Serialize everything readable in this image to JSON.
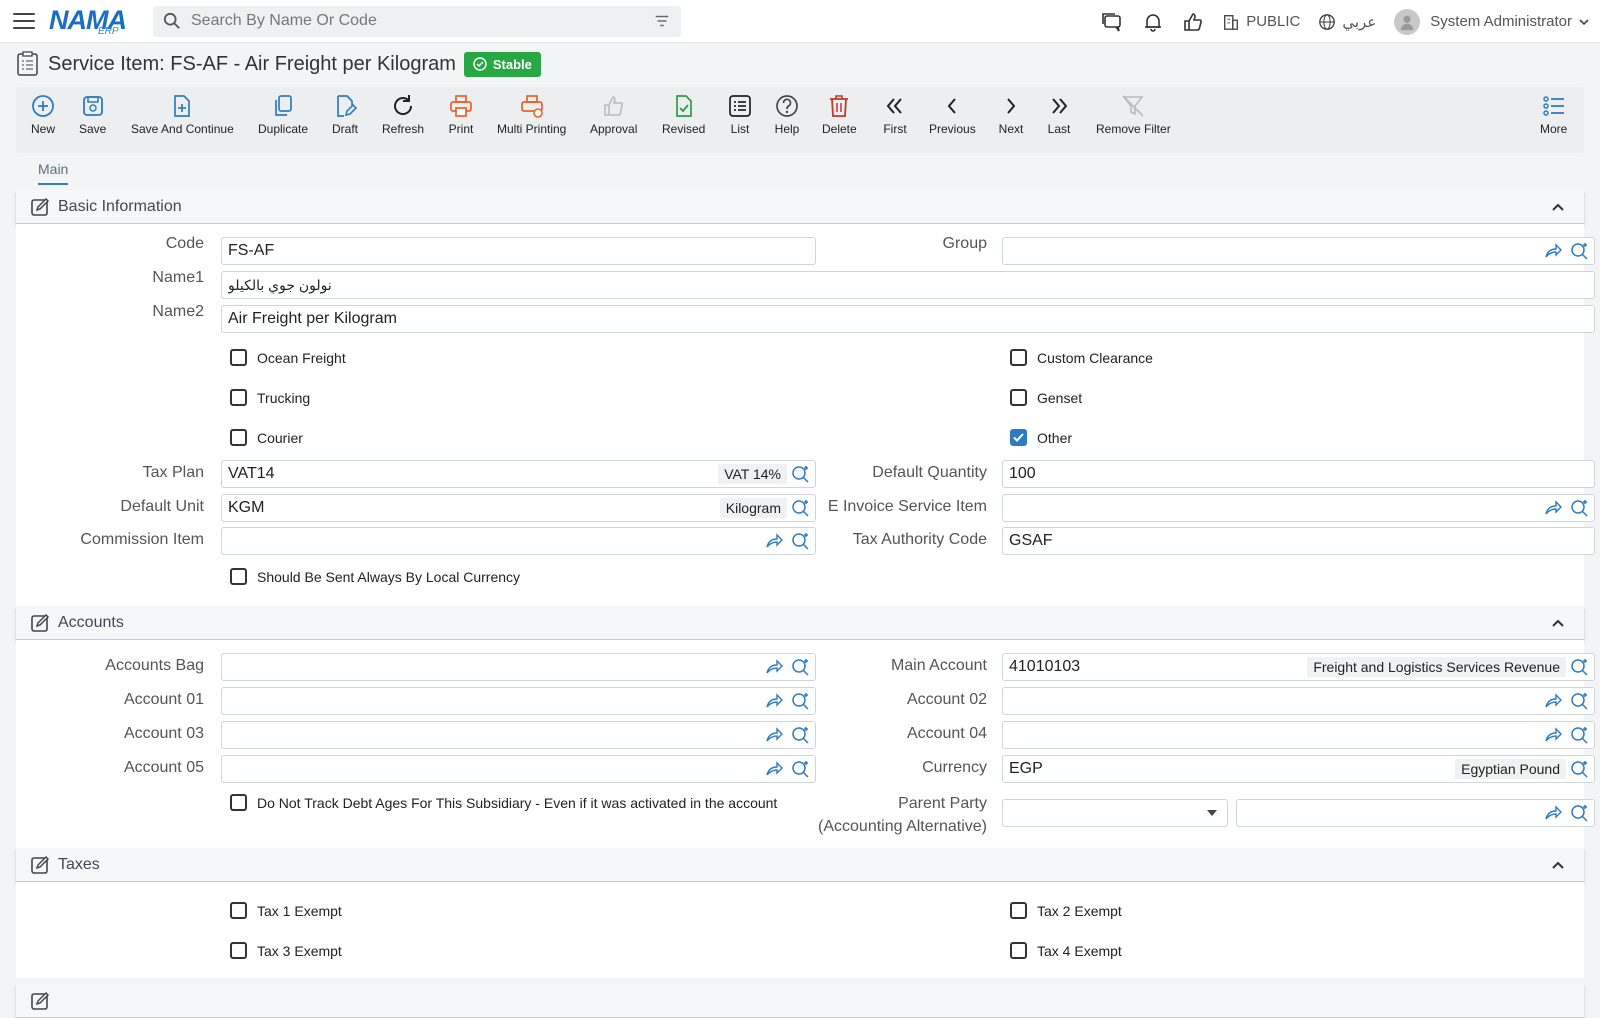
{
  "topbar": {
    "logo_main": "NAMA",
    "logo_sub": "ERP",
    "search_placeholder": "Search By Name Or Code",
    "branch": "PUBLIC",
    "language": "عربي",
    "user": "System Administrator"
  },
  "page": {
    "title": "Service Item: FS-AF - Air Freight per Kilogram",
    "status": "Stable"
  },
  "toolbar": {
    "new": "New",
    "save": "Save",
    "save_continue": "Save And Continue",
    "duplicate": "Duplicate",
    "draft": "Draft",
    "refresh": "Refresh",
    "print": "Print",
    "multi_printing": "Multi Printing",
    "approval": "Approval",
    "revised": "Revised",
    "list": "List",
    "help": "Help",
    "delete": "Delete",
    "first": "First",
    "previous": "Previous",
    "next": "Next",
    "last": "Last",
    "remove_filter": "Remove Filter",
    "more": "More"
  },
  "tabs": {
    "main": "Main"
  },
  "basic": {
    "title": "Basic Information",
    "code_label": "Code",
    "code_value": "FS-AF",
    "group_label": "Group",
    "group_value": "",
    "name1_label": "Name1",
    "name1_value": "نولون جوي بالكيلو",
    "name2_label": "Name2",
    "name2_value": "Air Freight per Kilogram",
    "ocean_freight": "Ocean Freight",
    "trucking": "Trucking",
    "courier": "Courier",
    "custom_clearance": "Custom Clearance",
    "genset": "Genset",
    "other": "Other",
    "tax_plan_label": "Tax Plan",
    "tax_plan_value": "VAT14",
    "tax_plan_desc": "VAT 14%",
    "default_qty_label": "Default Quantity",
    "default_qty_value": "100",
    "default_unit_label": "Default Unit",
    "default_unit_value": "KGM",
    "default_unit_desc": "Kilogram",
    "einvoice_label": "E Invoice Service Item",
    "einvoice_value": "",
    "commission_label": "Commission Item",
    "commission_value": "",
    "tax_authority_label": "Tax Authority Code",
    "tax_authority_value": "GSAF",
    "local_currency": "Should Be Sent Always By Local Currency"
  },
  "accounts": {
    "title": "Accounts",
    "bag_label": "Accounts Bag",
    "main_account_label": "Main Account",
    "main_account_value": "41010103",
    "main_account_desc": "Freight and Logistics Services Revenue",
    "account01_label": "Account 01",
    "account02_label": "Account 02",
    "account03_label": "Account 03",
    "account04_label": "Account 04",
    "account05_label": "Account 05",
    "currency_label": "Currency",
    "currency_value": "EGP",
    "currency_desc": "Egyptian Pound",
    "debt_ages": "Do Not Track Debt Ages For This Subsidiary - Even if it was activated in the account",
    "parent_party_label1": "Parent Party",
    "parent_party_label2": "(Accounting Alternative)"
  },
  "taxes": {
    "title": "Taxes",
    "tax1": "Tax 1 Exempt",
    "tax2": "Tax 2 Exempt",
    "tax3": "Tax 3 Exempt",
    "tax4": "Tax 4 Exempt"
  },
  "colors": {
    "accent": "#2d7cc3",
    "status": "#27a844",
    "print": "#e8622a",
    "delete": "#c0392b",
    "revised": "#2e9c4a"
  }
}
